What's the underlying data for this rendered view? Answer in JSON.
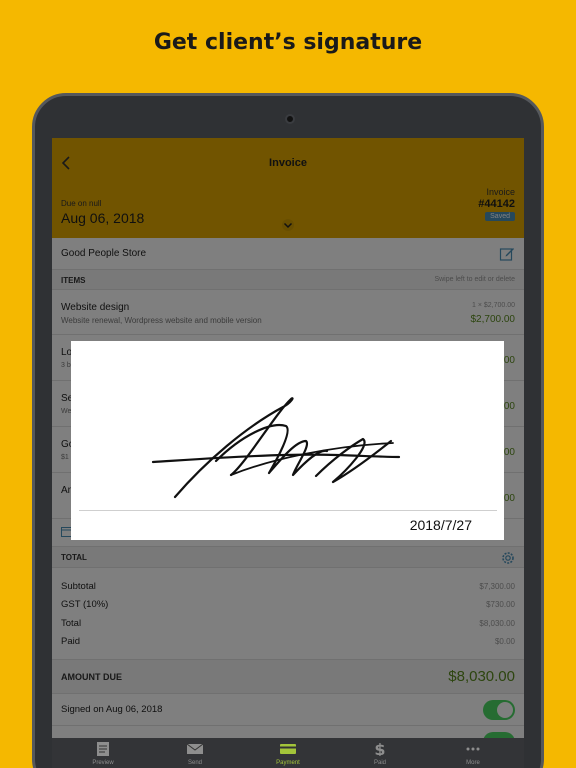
{
  "headline": "Get client’s signature",
  "topbar": {
    "title": "Invoice",
    "due_label": "Due on null",
    "due_date": "Aug 06, 2018",
    "invoice_label": "Invoice",
    "invoice_number": "#44142",
    "status_badge": "Saved"
  },
  "client": {
    "name": "Good People Store"
  },
  "items_section": {
    "title": "ITEMS",
    "hint": "Swipe left to edit or delete"
  },
  "items": [
    {
      "name": "Website design",
      "description": "Website renewal, Wordpress website and mobile version",
      "qty": "1 × $2,700.00",
      "amount": "$2,700.00"
    },
    {
      "name": "Lo",
      "description": "3 b",
      "amount": "00"
    },
    {
      "name": "Se",
      "description": "We",
      "amount": "00"
    },
    {
      "name": "Go",
      "description": "$1",
      "amount": "00"
    },
    {
      "name": "An",
      "amount": "00"
    }
  ],
  "total_section": {
    "title": "TOTAL"
  },
  "totals": [
    {
      "label": "Subtotal",
      "value": "$7,300.00"
    },
    {
      "label": "GST (10%)",
      "value": "$730.00"
    },
    {
      "label": "Total",
      "value": "$8,030.00"
    },
    {
      "label": "Paid",
      "value": "$0.00"
    }
  ],
  "amount_due": {
    "label": "AMOUNT DUE",
    "value": "$8,030.00"
  },
  "signed": {
    "label": "Signed on Aug 06, 2018",
    "toggle_on": true
  },
  "tabs": [
    {
      "label": "Preview",
      "icon": "document-icon"
    },
    {
      "label": "Send",
      "icon": "envelope-icon"
    },
    {
      "label": "Payment",
      "icon": "credit-card-icon",
      "active": true
    },
    {
      "label": "Paid",
      "icon": "dollar-icon"
    },
    {
      "label": "More",
      "icon": "more-dots-icon"
    }
  ],
  "signature": {
    "date": "2018/7/27"
  },
  "colors": {
    "background": "#F5B800",
    "header": "#E3A900",
    "accent_green": "#5a8a1e",
    "toggle_green": "#4cd964",
    "badge_blue": "#4a90b8"
  }
}
